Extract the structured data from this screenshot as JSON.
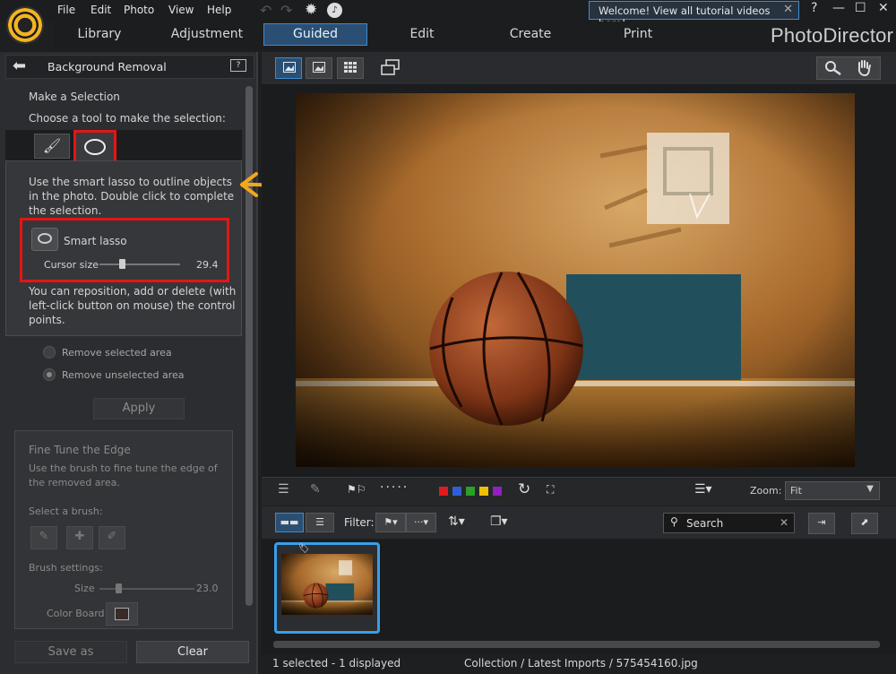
{
  "menu": [
    "File",
    "Edit",
    "Photo",
    "View",
    "Help"
  ],
  "welcome": "Welcome! View all tutorial videos here!",
  "window_buttons": [
    "?",
    "—",
    "☐",
    "✕"
  ],
  "modes": {
    "library": "Library",
    "adjustment": "Adjustment",
    "guided": "Guided",
    "edit": "Edit",
    "create": "Create",
    "print": "Print"
  },
  "brand": "PhotoDirector",
  "panel": {
    "title": "Background Removal",
    "make_selection": "Make a Selection",
    "choose_tool": "Choose a tool to make the selection:",
    "lasso_help_1": "Use the smart lasso to outline objects",
    "lasso_help_2": "in the photo. Double click to complete",
    "lasso_help_3": "the selection.",
    "smart_lasso": "Smart lasso",
    "cursor_size_label": "Cursor size",
    "cursor_size_value": "29.4",
    "cursor_size_fraction": 0.28,
    "reposition_1": "You can reposition, add or delete (with",
    "reposition_2": "left-click button on mouse) the control",
    "reposition_3": "points.",
    "remove_selected": "Remove selected area",
    "remove_unselected": "Remove unselected area",
    "apply": "Apply",
    "fine_tune_title": "Fine Tune the Edge",
    "fine_tune_1": "Use the brush to fine tune the edge of",
    "fine_tune_2": "the removed area.",
    "select_brush": "Select a brush:",
    "brush_settings": "Brush settings:",
    "size_label": "Size",
    "size_value": "23.0",
    "size_fraction": 0.2,
    "color_board": "Color Board",
    "save_as": "Save as",
    "clear": "Clear"
  },
  "filmstrip": {
    "zoom_label": "Zoom:",
    "zoom_value": "Fit",
    "filter_label": "Filter:",
    "search_placeholder": "Search",
    "colors": [
      "#e01b1b",
      "#2f5fd8",
      "#2aa02a",
      "#f0c000",
      "#9020c0"
    ]
  },
  "status": {
    "selection": "1 selected - 1 displayed",
    "path": "Collection / Latest Imports / 575454160.jpg"
  }
}
